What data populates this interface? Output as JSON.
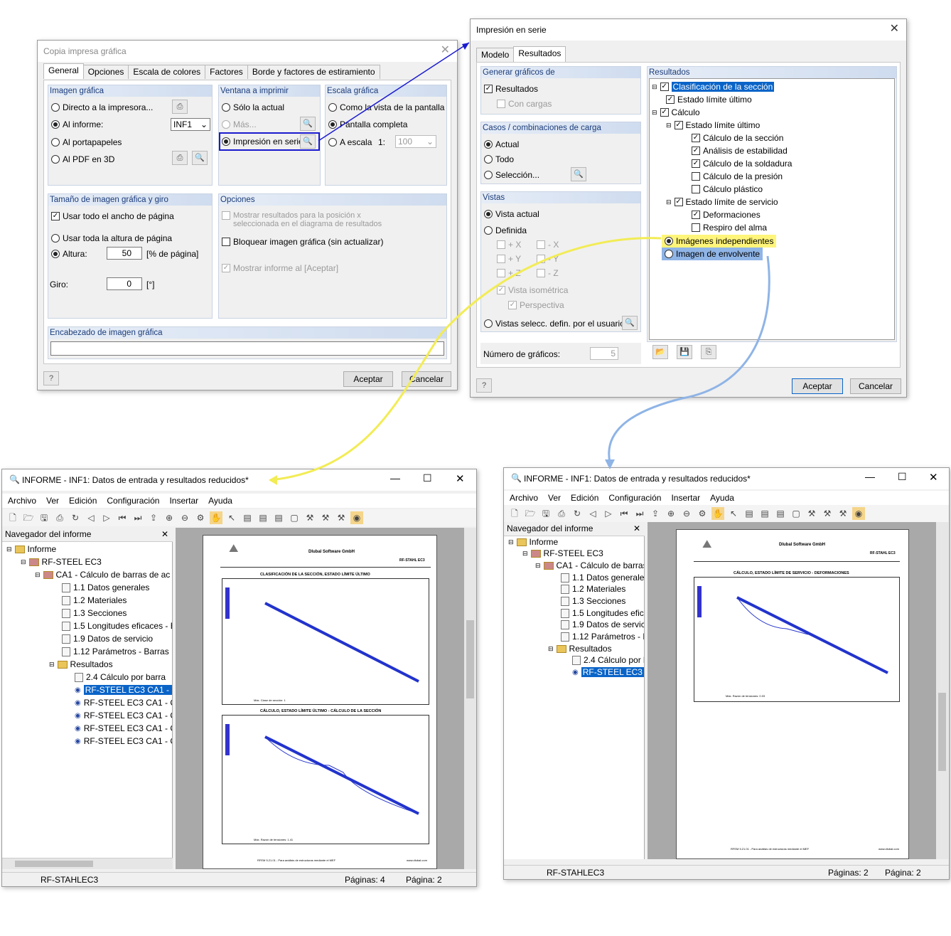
{
  "dialog1": {
    "title": "Copia impresa gráfica",
    "tabs": [
      "General",
      "Opciones",
      "Escala de colores",
      "Factores",
      "Borde y factores de estiramiento"
    ],
    "imagen_grafica": {
      "header": "Imagen gráfica",
      "opt1": "Directo a la impresora...",
      "opt2": "Al informe:",
      "opt2_value": "INF1",
      "opt3": "Al portapapeles",
      "opt4": "Al PDF en 3D"
    },
    "ventana": {
      "header": "Ventana a imprimir",
      "opt1": "Sólo la actual",
      "opt2": "Más...",
      "opt3": "Impresión en serie..."
    },
    "escala": {
      "header": "Escala gráfica",
      "opt1": "Como la vista de la pantalla",
      "opt2": "Pantalla completa",
      "opt3": "A escala",
      "ratio": "1:",
      "ratio_value": "100"
    },
    "tamano": {
      "header": "Tamaño de imagen gráfica y giro",
      "cb1": "Usar todo el ancho de página",
      "rb1": "Usar toda la altura de página",
      "rb2": "Altura:",
      "altura_value": "50",
      "altura_unit": "[% de página]",
      "giro_label": "Giro:",
      "giro_value": "0",
      "giro_unit": "[°]"
    },
    "opciones": {
      "header": "Opciones",
      "cb1": "Mostrar resultados para la posición x seleccionada en el diagrama de resultados",
      "cb2": "Bloquear imagen gráfica (sin actualizar)",
      "cb3": "Mostrar informe al [Aceptar]"
    },
    "encabezado": {
      "header": "Encabezado de imagen gráfica",
      "value": ""
    },
    "ok": "Aceptar",
    "cancel": "Cancelar"
  },
  "dialog2": {
    "title": "Impresión en serie",
    "tabs": [
      "Modelo",
      "Resultados"
    ],
    "generar": {
      "header": "Generar gráficos de",
      "cb1": "Resultados",
      "cb2": "Con cargas"
    },
    "casos": {
      "header": "Casos / combinaciones de carga",
      "rb1": "Actual",
      "rb2": "Todo",
      "rb3": "Selección..."
    },
    "vistas": {
      "header": "Vistas",
      "rb1": "Vista actual",
      "rb2": "Definida",
      "px": "+ X",
      "mx": "- X",
      "py": "+ Y",
      "my": "- Y",
      "pz": "+ Z",
      "mz": "- Z",
      "iso": "Vista isométrica",
      "persp": "Perspectiva",
      "rb3": "Vistas selecc. defin. por el usuario..."
    },
    "num_label": "Número de gráficos:",
    "num_value": "5",
    "resultados": {
      "header": "Resultados",
      "items": [
        "Clasificación de la sección",
        "Estado límite último",
        "Cálculo",
        "Estado límite último",
        "Cálculo de la sección",
        "Análisis de estabilidad",
        "Cálculo de la soldadura",
        "Cálculo de la presión",
        "Cálculo plástico",
        "Estado límite de servicio",
        "Deformaciones",
        "Respiro del alma",
        "Imágenes independientes",
        "Imagen de envolvente"
      ]
    },
    "ok": "Aceptar",
    "cancel": "Cancelar"
  },
  "report1": {
    "title": "INFORME - INF1: Datos de entrada y resultados reducidos*",
    "menu": [
      "Archivo",
      "Ver",
      "Edición",
      "Configuración",
      "Insertar",
      "Ayuda"
    ],
    "nav_title": "Navegador del informe",
    "tree": [
      "Informe",
      "RF-STEEL EC3",
      "CA1 - Cálculo de barras de ac",
      "1.1 Datos generales",
      "1.2 Materiales",
      "1.3 Secciones",
      "1.5 Longitudes eficaces - E",
      "1.9 Datos de servicio",
      "1.12 Parámetros - Barras",
      "Resultados",
      "2.4 Cálculo por barra",
      "RF-STEEL EC3 CA1 - C",
      "RF-STEEL EC3 CA1 - C",
      "RF-STEEL EC3 CA1 - C",
      "RF-STEEL EC3 CA1 - C",
      "RF-STEEL EC3 CA1 - C"
    ],
    "page_company": "Dlubal Software GmbH",
    "page_module": "RF-STAHL EC3",
    "fig1_title": "CLASIFICACIÓN DE LA SECCIÓN, ESTADO LÍMITE ÚLTIMO",
    "fig1_caption": "Máx. Clase de sección: 1",
    "fig2_title": "CÁLCULO, ESTADO LÍMITE ÚLTIMO - CÁLCULO DE LA SECCIÓN",
    "fig2_caption": "Máx. Razón de tensiones: 1.41",
    "footer": "RFEM 5.21.01 - Para análisis de estructuras mediante el MEF",
    "footer_right": "www.dlubal.com",
    "status_left": "RF-STAHLEC3",
    "status_pages": "Páginas: 4",
    "status_page": "Página: 2"
  },
  "report2": {
    "title": "INFORME - INF1: Datos de entrada y resultados reducidos*",
    "menu": [
      "Archivo",
      "Ver",
      "Edición",
      "Configuración",
      "Insertar",
      "Ayuda"
    ],
    "nav_title": "Navegador del informe",
    "tree": [
      "Informe",
      "RF-STEEL EC3",
      "CA1 - Cálculo de barras d",
      "1.1 Datos generales",
      "1.2 Materiales",
      "1.3 Secciones",
      "1.5 Longitudes eficac",
      "1.9 Datos de servicio",
      "1.12 Parámetros - Bar",
      "Resultados",
      "2.4 Cálculo por ba",
      "RF-STEEL EC3 CA"
    ],
    "page_company": "Dlubal Software GmbH",
    "page_module": "RF-STAHL EC3",
    "fig_title": "CÁLCULO, ESTADO LÍMITE DE SERVICIO - DEFORMACIONES",
    "fig_caption": "Máx. Razón de tensiones: 0.03",
    "footer": "RFEM 5.21.01 - Para análisis de estructuras mediante el MEF",
    "footer_right": "www.dlubal.com",
    "status_left": "RF-STAHLEC3",
    "status_pages": "Páginas: 2",
    "status_page": "Página: 2"
  },
  "colors": {
    "accent_blue": "#0a64c8",
    "highlight_yellow": "#fff57a",
    "highlight_blue": "#8fb4e6",
    "group_header": "#1b3c7a"
  }
}
